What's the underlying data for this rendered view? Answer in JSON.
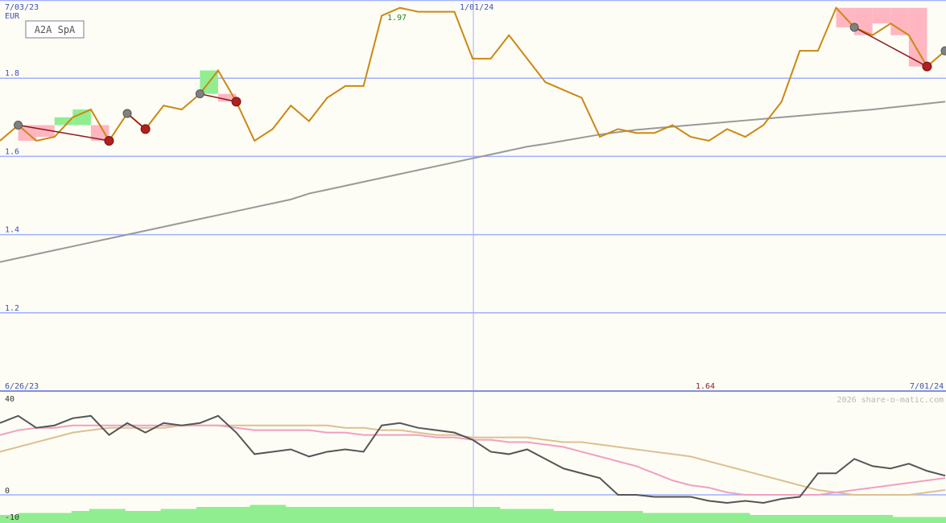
{
  "chart_data": [
    {
      "type": "line",
      "title": "A2A SpA",
      "unit_label": "EUR",
      "start_date_label": "7/03/23",
      "mid_date_label": "1/01/24",
      "ylim": [
        1.0,
        2.0
      ],
      "y_ticks": [
        {
          "value": 1.8,
          "label": "1.8"
        },
        {
          "value": 1.6,
          "label": "1.6"
        },
        {
          "value": 1.4,
          "label": "1.4"
        },
        {
          "value": 1.2,
          "label": "1.2"
        }
      ],
      "high_label": "1.97",
      "low_label": "1.64",
      "price_series": [
        1.64,
        1.68,
        1.64,
        1.65,
        1.7,
        1.72,
        1.64,
        1.71,
        1.67,
        1.73,
        1.72,
        1.76,
        1.82,
        1.74,
        1.64,
        1.67,
        1.73,
        1.69,
        1.75,
        1.78,
        1.78,
        1.96,
        1.98,
        1.97,
        1.97,
        1.97,
        1.85,
        1.85,
        1.91,
        1.85,
        1.79,
        1.77,
        1.75,
        1.65,
        1.67,
        1.66,
        1.66,
        1.68,
        1.65,
        1.64,
        1.67,
        1.65,
        1.68,
        1.74,
        1.87,
        1.87,
        1.98,
        1.93,
        1.91,
        1.94,
        1.91,
        1.83,
        1.87
      ],
      "moving_average_series": [
        1.33,
        1.34,
        1.35,
        1.36,
        1.37,
        1.38,
        1.39,
        1.4,
        1.41,
        1.42,
        1.43,
        1.44,
        1.45,
        1.46,
        1.47,
        1.48,
        1.49,
        1.505,
        1.515,
        1.525,
        1.535,
        1.545,
        1.555,
        1.565,
        1.575,
        1.585,
        1.595,
        1.605,
        1.615,
        1.625,
        1.632,
        1.64,
        1.648,
        1.656,
        1.662,
        1.668,
        1.672,
        1.676,
        1.68,
        1.684,
        1.688,
        1.692,
        1.696,
        1.7,
        1.704,
        1.708,
        1.712,
        1.716,
        1.72,
        1.725,
        1.73,
        1.735,
        1.74
      ]
    },
    {
      "type": "line",
      "start_date_label": "6/26/23",
      "end_date_label": "7/01/24",
      "watermark": "2026 share-o-matic.com",
      "y_ticks": [
        {
          "value": 40,
          "label": "40"
        },
        {
          "value": 0,
          "label": "0"
        },
        {
          "value": -10,
          "label": "-10"
        }
      ],
      "ylim": [
        -12,
        42
      ],
      "series": [
        {
          "color": "#555555",
          "values": [
            30,
            33,
            28,
            29,
            32,
            33,
            25,
            30,
            26,
            30,
            29,
            30,
            33,
            26,
            17,
            18,
            19,
            16,
            18,
            19,
            18,
            29,
            30,
            28,
            27,
            26,
            23,
            18,
            17,
            19,
            15,
            11,
            9,
            7,
            0,
            0,
            -1,
            -1,
            -1,
            -3,
            -4,
            -3,
            -4,
            -2,
            -1,
            9,
            9,
            15,
            12,
            11,
            13,
            10,
            8
          ]
        },
        {
          "color": "#f0a0c0",
          "values": [
            25,
            27,
            28,
            28,
            29,
            29,
            29,
            29,
            29,
            29,
            29,
            29,
            29,
            28,
            27,
            27,
            27,
            27,
            26,
            26,
            25,
            25,
            25,
            25,
            24,
            24,
            23,
            23,
            22,
            22,
            21,
            20,
            18,
            16,
            14,
            12,
            9,
            6,
            4,
            3,
            1,
            0,
            0,
            0,
            0,
            0,
            1,
            2,
            3,
            4,
            5,
            6,
            7
          ]
        },
        {
          "color": "#ddc090",
          "values": [
            18,
            20,
            22,
            24,
            26,
            27,
            28,
            28,
            28,
            28,
            29,
            29,
            29,
            29,
            29,
            29,
            29,
            29,
            29,
            28,
            28,
            27,
            27,
            26,
            25,
            25,
            24,
            24,
            24,
            24,
            23,
            22,
            22,
            21,
            20,
            19,
            18,
            17,
            16,
            14,
            12,
            10,
            8,
            6,
            4,
            2,
            1,
            0,
            0,
            0,
            0,
            1,
            2
          ]
        }
      ],
      "histogram_values": [
        -10,
        -9,
        -9,
        -9,
        -8,
        -7,
        -7,
        -8,
        -8,
        -7,
        -7,
        -6,
        -6,
        -6,
        -5,
        -5,
        -6,
        -6,
        -6,
        -6,
        -6,
        -6,
        -6,
        -6,
        -6,
        -6,
        -6,
        -6,
        -7,
        -7,
        -7,
        -8,
        -8,
        -8,
        -8,
        -8,
        -9,
        -9,
        -9,
        -9,
        -9,
        -9,
        -10,
        -10,
        -10,
        -10,
        -10,
        -10,
        -10,
        -10,
        -11,
        -11,
        -11
      ]
    }
  ],
  "colors": {
    "background": "#fdfdf6",
    "grid": "#a0b0ff",
    "axis_text": "#4050b0",
    "price": "#cc8811",
    "moving_average": "#999999",
    "high_label": "#228822",
    "low_label": "#882222",
    "histogram": "#90ee90",
    "marker_grey": "#808080",
    "marker_red": "#b02020",
    "gain_fill": "#90ee90",
    "loss_fill": "#ffb6c1"
  }
}
